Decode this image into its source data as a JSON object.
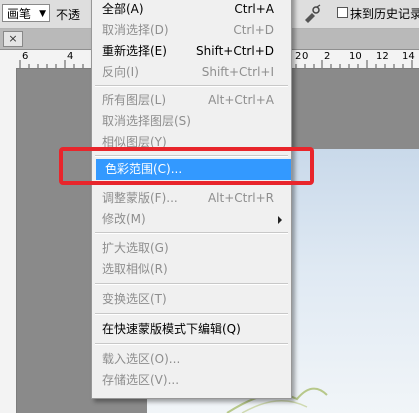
{
  "options_bar": {
    "tool_preset": "画笔",
    "opacity_label": "不透",
    "erase_to_history_label": "抹到历史记录"
  },
  "icons": {
    "tab_close": "close-icon",
    "airbrush": "airbrush-icon",
    "submenu": "chevron-right-icon"
  },
  "ruler": {
    "labels": [
      "6",
      "4",
      "2",
      "0",
      "2",
      "10",
      "12",
      "14"
    ]
  },
  "menu": {
    "items": [
      {
        "label": "全部(A)",
        "shortcut": "Ctrl+A",
        "enabled": true
      },
      {
        "label": "取消选择(D)",
        "shortcut": "Ctrl+D",
        "enabled": false
      },
      {
        "label": "重新选择(E)",
        "shortcut": "Shift+Ctrl+D",
        "enabled": true
      },
      {
        "label": "反向(I)",
        "shortcut": "Shift+Ctrl+I",
        "enabled": false
      },
      {
        "label": "所有图层(L)",
        "shortcut": "Alt+Ctrl+A",
        "enabled": false
      },
      {
        "label": "取消选择图层(S)",
        "shortcut": "",
        "enabled": false
      },
      {
        "label": "相似图层(Y)",
        "shortcut": "",
        "enabled": false
      },
      {
        "label": "色彩范围(C)...",
        "shortcut": "",
        "enabled": true,
        "highlighted": true
      },
      {
        "label": "调整蒙版(F)...",
        "shortcut": "Alt+Ctrl+R",
        "enabled": false
      },
      {
        "label": "修改(M)",
        "shortcut": "",
        "enabled": false,
        "submenu": true
      },
      {
        "label": "扩大选取(G)",
        "shortcut": "",
        "enabled": false
      },
      {
        "label": "选取相似(R)",
        "shortcut": "",
        "enabled": false
      },
      {
        "label": "变换选区(T)",
        "shortcut": "",
        "enabled": false
      },
      {
        "label": "在快速蒙版模式下编辑(Q)",
        "shortcut": "",
        "enabled": true
      },
      {
        "label": "载入选区(O)...",
        "shortcut": "",
        "enabled": false
      },
      {
        "label": "存储选区(V)...",
        "shortcut": "",
        "enabled": false
      }
    ]
  },
  "colors": {
    "highlight": "#3399ff",
    "annotation_box": "#e8252b"
  }
}
